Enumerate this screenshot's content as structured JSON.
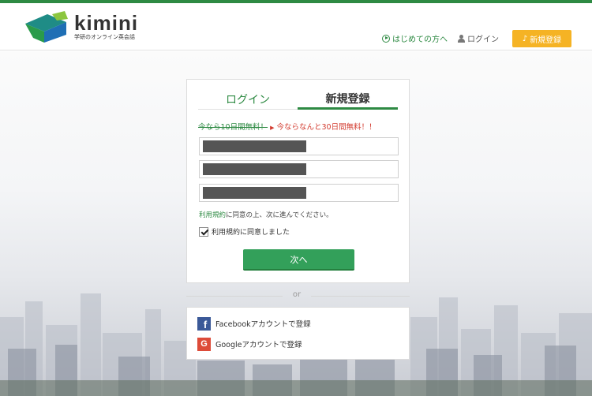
{
  "brand": {
    "name": "kimini",
    "tagline": "学研のオンライン英会話",
    "colors": {
      "primary_green": "#2e8a43",
      "accent_yellow": "#f5b324",
      "promo_red": "#d23a2e",
      "logo_teal": "#1f8c86",
      "logo_blue": "#1f6fb5"
    }
  },
  "nav": {
    "first_time": "はじめての方へ",
    "first_time_icon": "play-circle-icon",
    "login": "ログイン",
    "login_icon": "person-icon",
    "signup": "新規登録",
    "signup_icon": "music-note-icon"
  },
  "form": {
    "tabs": [
      {
        "label": "ログイン",
        "active": false
      },
      {
        "label": "新規登録",
        "active": true
      }
    ],
    "promo": {
      "old": "今なら10日間無料！",
      "arrow": "▶",
      "new": "今ならなんと30日間無料！！"
    },
    "fields": [
      {
        "value": "",
        "masked": true
      },
      {
        "value": "",
        "masked": true
      },
      {
        "value": "",
        "masked": true
      }
    ],
    "terms_link": "利用規約",
    "terms_rest": "に同意の上、次に進んでください。",
    "checkbox_label": "利用規約に同意しました",
    "checkbox_checked": true,
    "next_button": "次へ"
  },
  "divider": {
    "or": "or"
  },
  "social": {
    "facebook": {
      "label": "Facebookアカウントで登録",
      "icon": "facebook-icon",
      "glyph": "f"
    },
    "google": {
      "label": "Googleアカウントで登録",
      "icon": "google-icon",
      "glyph": "G"
    }
  }
}
